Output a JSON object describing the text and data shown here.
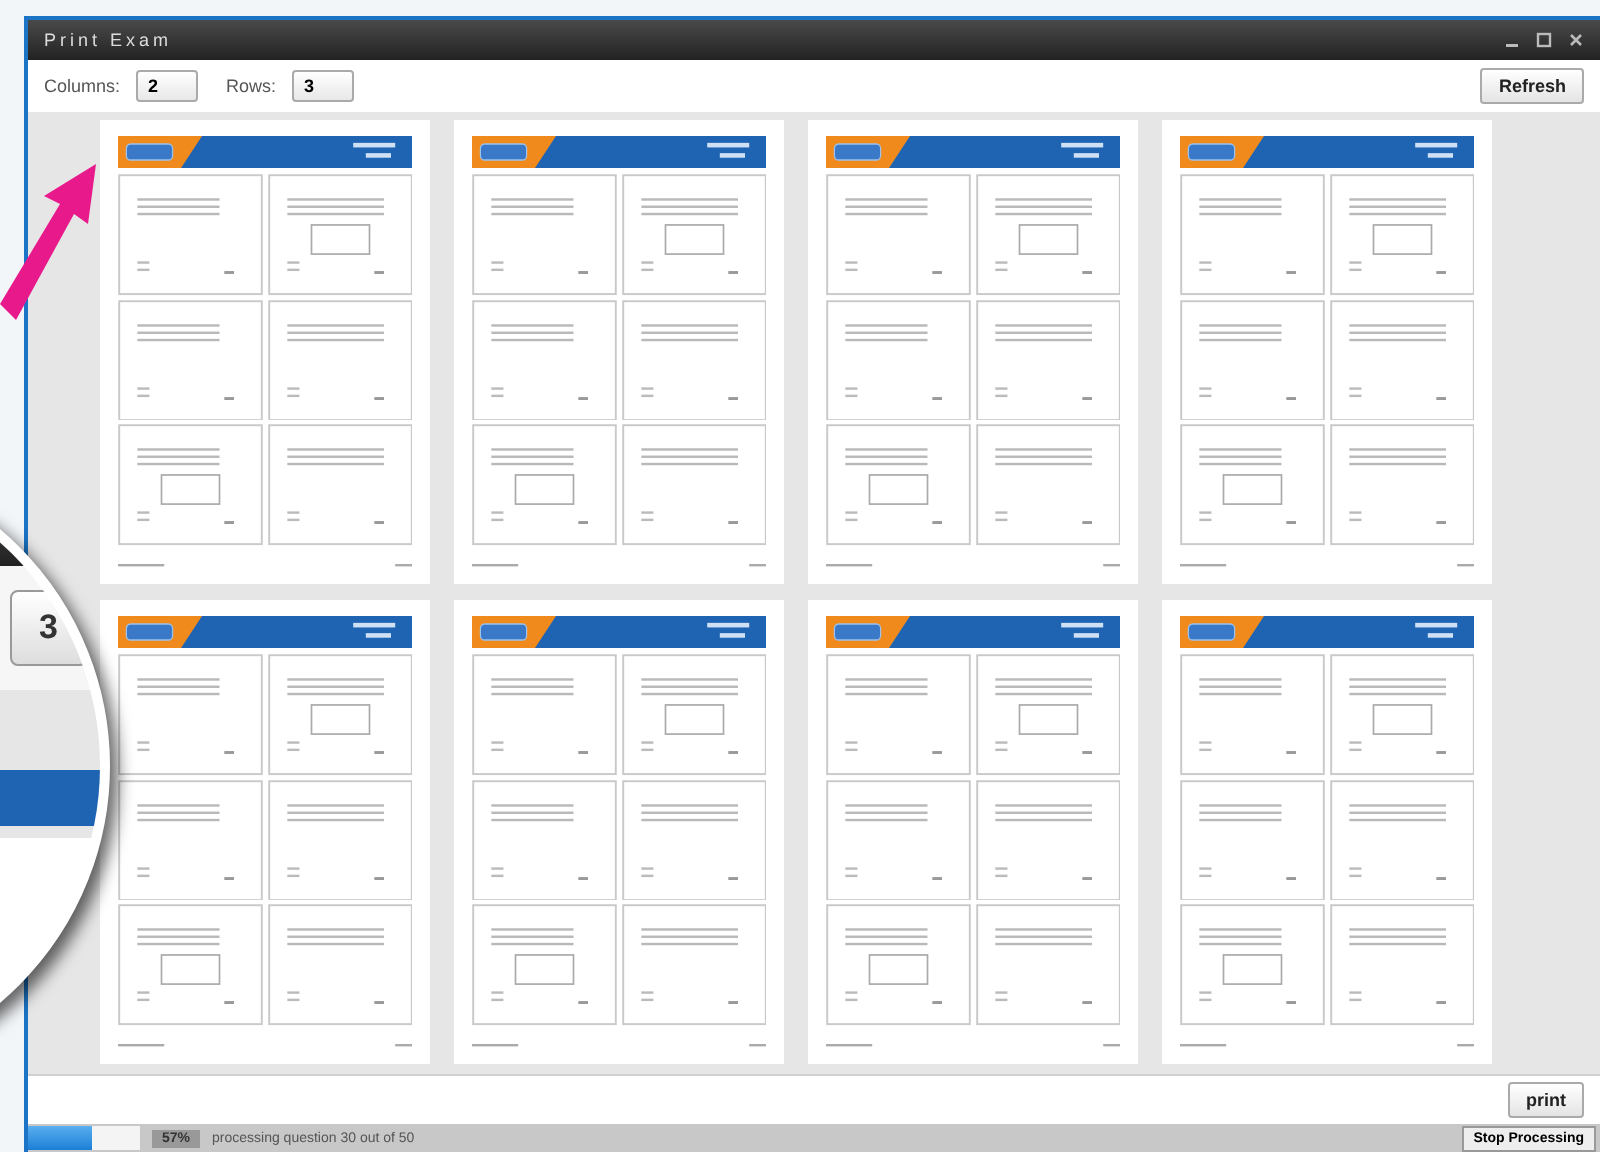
{
  "window": {
    "title": "Print Exam"
  },
  "toolbar": {
    "columns_label": "Columns:",
    "columns_value": "2",
    "rows_label": "Rows:",
    "rows_value": "3",
    "refresh_button": "Refresh"
  },
  "pages": [
    {
      "kind": "exam-page"
    },
    {
      "kind": "exam-page"
    },
    {
      "kind": "exam-page"
    },
    {
      "kind": "exam-page"
    },
    {
      "kind": "exam-page"
    },
    {
      "kind": "exam-page"
    },
    {
      "kind": "exam-page"
    },
    {
      "kind": "exam-page"
    }
  ],
  "print_button": "print",
  "status_bar": {
    "progress": {
      "level": 0.57,
      "reading": "57%"
    },
    "message": "processing question 30 out of 50",
    "stop_button": "Stop Processing"
  },
  "magnifier": {
    "rows_value": "3"
  }
}
